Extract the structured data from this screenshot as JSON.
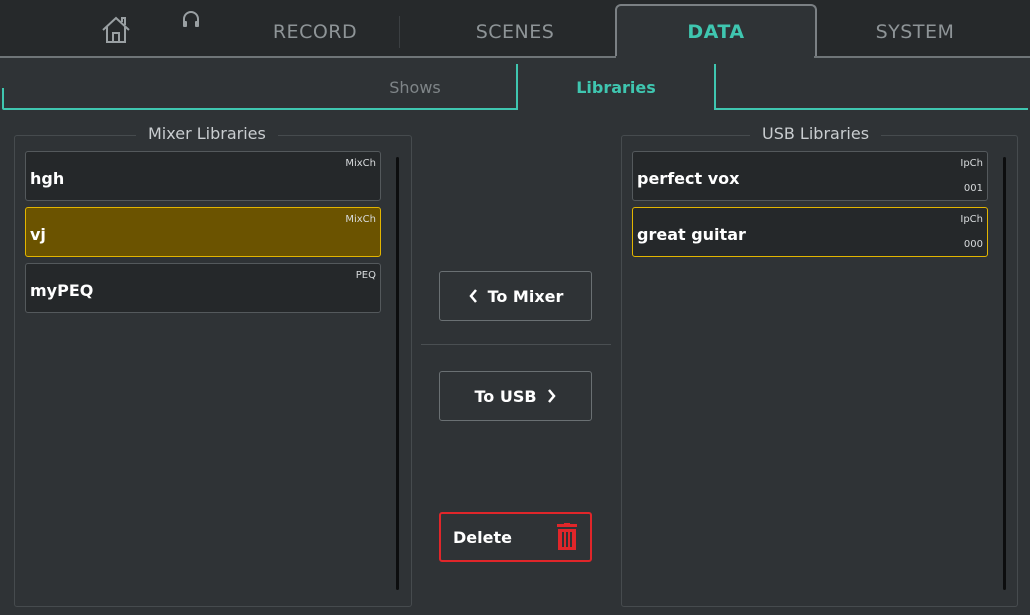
{
  "top_tabs": {
    "home": "home-icon",
    "headphones": "headphones-icon",
    "record": "RECORD",
    "scenes": "SCENES",
    "data": "DATA",
    "system": "SYSTEM"
  },
  "sub_tabs": {
    "shows": "Shows",
    "libraries": "Libraries"
  },
  "mixer_panel": {
    "title": "Mixer Libraries",
    "items": [
      {
        "name": "hgh",
        "tag": "MixCh",
        "selected": false
      },
      {
        "name": "vj",
        "tag": "MixCh",
        "selected": true
      },
      {
        "name": "myPEQ",
        "tag": "PEQ",
        "selected": false
      }
    ]
  },
  "usb_panel": {
    "title": "USB Libraries",
    "items": [
      {
        "name": "perfect vox",
        "tag": "IpCh",
        "num": "001",
        "selected": false
      },
      {
        "name": "great guitar",
        "tag": "IpCh",
        "num": "000",
        "selected": true
      }
    ]
  },
  "actions": {
    "to_mixer": "To Mixer",
    "to_usb": "To USB",
    "delete": "Delete"
  },
  "colors": {
    "accent": "#3fc6b0",
    "selected": "#e2b500",
    "delete": "#e0262a"
  }
}
